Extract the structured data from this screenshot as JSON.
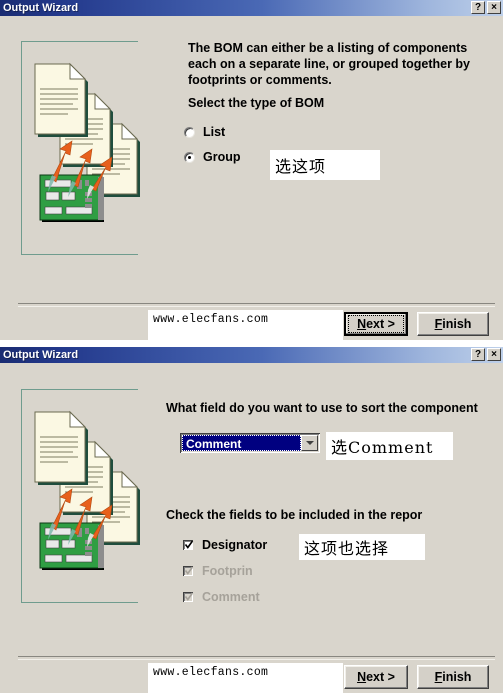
{
  "window": {
    "title": "Output Wizard",
    "help_button": "?",
    "close_button": "×",
    "help_icon_name": "help-icon",
    "close_icon_name": "close-icon"
  },
  "colors": {
    "titlebar_start": "#1a2c72",
    "titlebar_end": "#bed0ea",
    "dialog_face": "#d9d5cc",
    "button_face": "#d4d0c8",
    "selection": "#000080",
    "disabled_text": "#a6a29a",
    "illustration_border": "#6f9c8e",
    "pcb_green": "#2f9e43",
    "arrow_orange": "#e8601c"
  },
  "page1": {
    "intro_lines": [
      "The BOM can either be a listing of components",
      "each on a separate line, or grouped together by",
      "footprints or comments."
    ],
    "prompt": "Select the type of BOM",
    "radios": [
      {
        "label": "List",
        "checked": false
      },
      {
        "label": "Group",
        "checked": true
      }
    ],
    "annotation": "选这项",
    "watermark": "www.elecfans.com",
    "buttons": [
      {
        "label": "Next >",
        "accel": "N",
        "focused": true
      },
      {
        "label": "Finish",
        "accel": "F",
        "focused": false
      }
    ]
  },
  "page2": {
    "prompt": "What field do you want to use to sort the component",
    "combo": {
      "value": "Comment",
      "arrow_icon": "chevron-down-icon"
    },
    "combo_annotation": "选Comment",
    "checks_prompt": "Check the fields to be included in the repor",
    "checkboxes": [
      {
        "label": "Designator",
        "checked": true,
        "disabled": false
      },
      {
        "label": "Footprin",
        "checked": true,
        "disabled": true
      },
      {
        "label": "Comment",
        "checked": true,
        "disabled": true
      }
    ],
    "checks_annotation": "这项也选择",
    "watermark": "www.elecfans.com",
    "buttons": [
      {
        "label": "Next >",
        "accel": "N",
        "focused": false
      },
      {
        "label": "Finish",
        "accel": "F",
        "focused": false
      }
    ]
  }
}
